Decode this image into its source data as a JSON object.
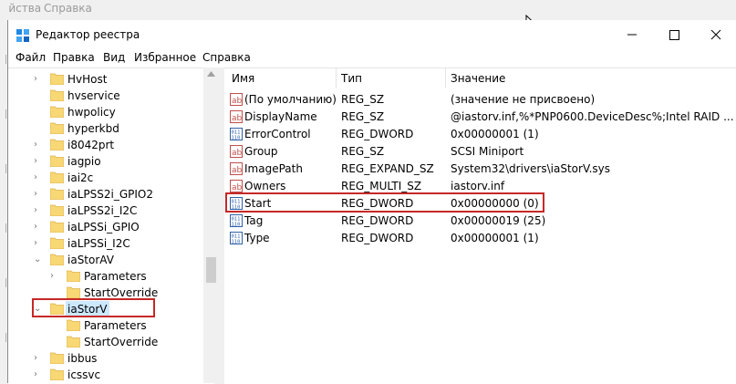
{
  "background_menu": {
    "items": [
      "ойства",
      "Справка"
    ]
  },
  "window": {
    "title": "Редактор реестра",
    "accent": "#c62828",
    "selection_bg": "#cce8ff"
  },
  "menubar": {
    "items": [
      "Файл",
      "Правка",
      "Вид",
      "Избранное",
      "Справка"
    ]
  },
  "tree": {
    "nodes": [
      {
        "label": "HvHost",
        "chevron": "›"
      },
      {
        "label": "hvservice",
        "chevron": ""
      },
      {
        "label": "hwpolicy",
        "chevron": ""
      },
      {
        "label": "hyperkbd",
        "chevron": ""
      },
      {
        "label": "i8042prt",
        "chevron": "›"
      },
      {
        "label": "iagpio",
        "chevron": "›"
      },
      {
        "label": "iai2c",
        "chevron": "›"
      },
      {
        "label": "iaLPSS2i_GPIO2",
        "chevron": "›"
      },
      {
        "label": "iaLPSS2i_I2C",
        "chevron": "›"
      },
      {
        "label": "iaLPSSi_GPIO",
        "chevron": "›"
      },
      {
        "label": "iaLPSSi_I2C",
        "chevron": "›"
      },
      {
        "label": "iaStorAV",
        "chevron": "⌄"
      },
      {
        "label": "Parameters",
        "chevron": "›"
      },
      {
        "label": "StartOverride",
        "chevron": ""
      },
      {
        "label": "iaStorV",
        "chevron": "⌄"
      },
      {
        "label": "Parameters",
        "chevron": ""
      },
      {
        "label": "StartOverride",
        "chevron": ""
      },
      {
        "label": "ibbus",
        "chevron": "›"
      },
      {
        "label": "icssvc",
        "chevron": "›"
      }
    ]
  },
  "list": {
    "columns": [
      "Имя",
      "Тип",
      "Значение"
    ],
    "rows": [
      {
        "icon": "string-value-icon",
        "name": "(По умолчанию)",
        "type": "REG_SZ",
        "value": "(значение не присвоено)"
      },
      {
        "icon": "string-value-icon",
        "name": "DisplayName",
        "type": "REG_SZ",
        "value": "@iastorv.inf,%*PNP0600.DeviceDesc%;Intel RAID ..."
      },
      {
        "icon": "binary-value-icon",
        "name": "ErrorControl",
        "type": "REG_DWORD",
        "value": "0x00000001 (1)"
      },
      {
        "icon": "string-value-icon",
        "name": "Group",
        "type": "REG_SZ",
        "value": "SCSI Miniport"
      },
      {
        "icon": "string-value-icon",
        "name": "ImagePath",
        "type": "REG_EXPAND_SZ",
        "value": "System32\\drivers\\iaStorV.sys"
      },
      {
        "icon": "string-value-icon",
        "name": "Owners",
        "type": "REG_MULTI_SZ",
        "value": "iastorv.inf"
      },
      {
        "icon": "binary-value-icon",
        "name": "Start",
        "type": "REG_DWORD",
        "value": "0x00000000 (0)"
      },
      {
        "icon": "binary-value-icon",
        "name": "Tag",
        "type": "REG_DWORD",
        "value": "0x00000019 (25)"
      },
      {
        "icon": "binary-value-icon",
        "name": "Type",
        "type": "REG_DWORD",
        "value": "0x00000001 (1)"
      }
    ]
  }
}
